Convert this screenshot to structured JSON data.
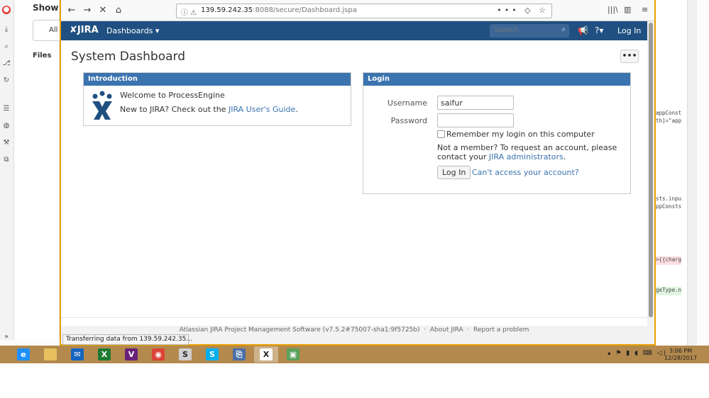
{
  "background_app": {
    "heading": "Show d",
    "filter_label": "All",
    "files_label": "Files",
    "code_lines": [
      "appConst",
      "th]=\"app",
      "sts.inpu",
      "ppConsts",
      ">{{charg",
      "geType.n"
    ]
  },
  "browser": {
    "url_host": "139.59.242.35",
    "url_path": ":8088/secure/Dashboard.jspa",
    "status_text": "Transferring data from 139.59.242.35..."
  },
  "jira": {
    "logo": "JIRA",
    "nav_dashboards": "Dashboards ▾",
    "search_placeholder": "Search",
    "help_label": "?▾",
    "login_link": "Log In",
    "page_title": "System Dashboard",
    "more_label": "•••",
    "intro": {
      "title": "Introduction",
      "welcome": "Welcome to ProcessEngine",
      "new_prefix": "New to JIRA? Check out the ",
      "guide_link": "JIRA User's Guide",
      "new_suffix": "."
    },
    "login": {
      "title": "Login",
      "username_label": "Username",
      "username_value": "saifur",
      "password_label": "Password",
      "remember_label": "Remember my login on this computer",
      "notmember_text": "Not a member? To request an account, please contact your ",
      "admins_link": "JIRA administrators",
      "notmember_suffix": ".",
      "login_button": "Log In",
      "cant_access": "Can't access your account?"
    },
    "footer": {
      "software": "Atlassian JIRA Project Management Software (v7.5.2#75007-sha1:9f5725b)",
      "sep": "·",
      "about": "About JIRA",
      "report": "Report a problem"
    }
  },
  "taskbar": {
    "time": "3:06 PM",
    "date": "12/28/2017",
    "apps": [
      {
        "name": "internet-explorer",
        "color": "#1e90ff",
        "glyph": "e"
      },
      {
        "name": "file-explorer",
        "color": "#e8c060",
        "glyph": ""
      },
      {
        "name": "mail",
        "color": "#1565c0",
        "glyph": "✉"
      },
      {
        "name": "excel",
        "color": "#1e7b34",
        "glyph": "X"
      },
      {
        "name": "visual-studio",
        "color": "#68217a",
        "glyph": "V"
      },
      {
        "name": "chrome",
        "color": "#db4437",
        "glyph": "◉"
      },
      {
        "name": "sublime",
        "color": "#d0d0d0",
        "glyph": "S"
      },
      {
        "name": "skype",
        "color": "#00aff0",
        "glyph": "S"
      },
      {
        "name": "network",
        "color": "#4a6fa5",
        "glyph": "⎘"
      },
      {
        "name": "xming",
        "color": "#ffffff",
        "glyph": "X"
      },
      {
        "name": "image-viewer",
        "color": "#5aa05a",
        "glyph": "▣"
      }
    ]
  }
}
